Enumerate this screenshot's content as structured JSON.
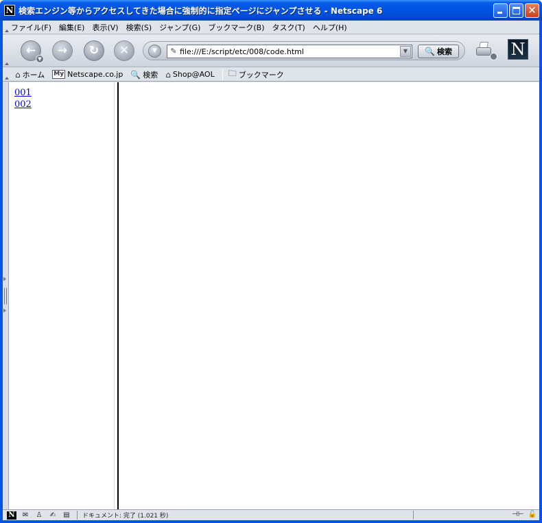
{
  "window": {
    "app_icon_letter": "N",
    "title": "検索エンジン等からアクセスしてきた場合に強制的に指定ページにジャンプさせる - Netscape 6"
  },
  "menubar": {
    "items": [
      {
        "label": "ファイル(F)"
      },
      {
        "label": "編集(E)"
      },
      {
        "label": "表示(V)"
      },
      {
        "label": "検索(S)"
      },
      {
        "label": "ジャンプ(G)"
      },
      {
        "label": "ブックマーク(B)"
      },
      {
        "label": "タスク(T)"
      },
      {
        "label": "ヘルプ(H)"
      }
    ]
  },
  "navbar": {
    "back_icon": "back-arrow-icon",
    "forward_icon": "forward-arrow-icon",
    "reload_icon": "reload-icon",
    "stop_icon": "stop-icon",
    "url": "file:///E:/script/etc/008/code.html",
    "search_label": "検索",
    "brand_logo_letter": "N"
  },
  "personalbar": {
    "home_label": "ホーム",
    "my_badge": "My",
    "netscape_label": "Netscape.co.jp",
    "search_label": "検索",
    "shop_label": "Shop@AOL",
    "bookmarks_label": "ブックマーク"
  },
  "content": {
    "left_frame_links": [
      {
        "label": "001"
      },
      {
        "label": "002"
      }
    ]
  },
  "statusbar": {
    "status_text": "ドキュメント: 完了 (1.021 秒)"
  },
  "colors": {
    "titlebar": "#0054e3",
    "link": "#0000ee",
    "chrome": "#dfe3ea"
  }
}
